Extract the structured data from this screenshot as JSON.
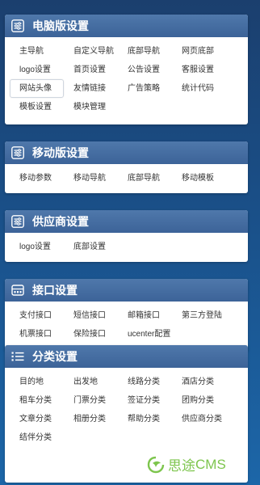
{
  "panels": [
    {
      "title": "电脑版设置",
      "icon": "sliders-icon",
      "items": [
        "主导航",
        "自定义导航",
        "底部导航",
        "网页底部",
        "logo设置",
        "首页设置",
        "公告设置",
        "客服设置",
        "网站头像",
        "友情链接",
        "广告策略",
        "统计代码",
        "模板设置",
        "模块管理"
      ],
      "selected": "网站头像"
    },
    {
      "title": "移动版设置",
      "icon": "sliders-icon",
      "items": [
        "移动参数",
        "移动导航",
        "底部导航",
        "移动模板"
      ]
    },
    {
      "title": "供应商设置",
      "icon": "sliders-icon",
      "items": [
        "logo设置",
        "底部设置"
      ]
    },
    {
      "title": "接口设置",
      "icon": "interface-icon",
      "items": [
        "支付接口",
        "短信接口",
        "邮箱接口",
        "第三方登陆",
        "机票接口",
        "保险接口",
        "ucenter配置"
      ]
    },
    {
      "title": "分类设置",
      "icon": "list-icon",
      "items": [
        "目的地",
        "出发地",
        "线路分类",
        "酒店分类",
        "租车分类",
        "门票分类",
        "签证分类",
        "团购分类",
        "文章分类",
        "相册分类",
        "帮助分类",
        "供应商分类",
        "结伴分类"
      ]
    }
  ],
  "watermark": {
    "brand": "思途",
    "suffix": "CMS",
    "color": "#6fbf3a"
  }
}
